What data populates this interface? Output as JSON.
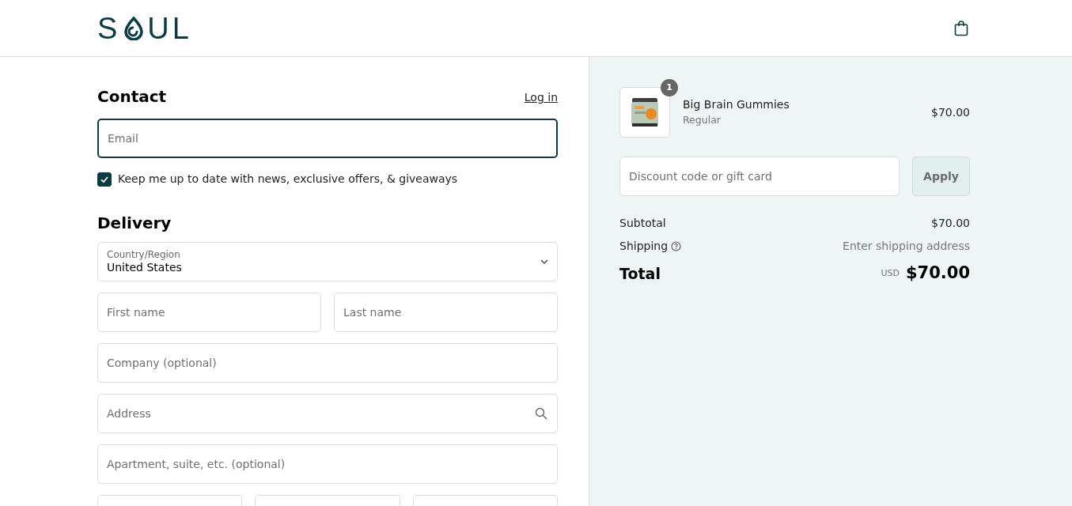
{
  "header": {
    "logo_start": "S",
    "logo_end": "UL"
  },
  "contact": {
    "title": "Contact",
    "login_link": "Log in",
    "email": {
      "placeholder": "Email"
    },
    "newsletter": {
      "label": "Keep me up to date with news, exclusive offers, & giveaways",
      "checked": true
    }
  },
  "delivery": {
    "title": "Delivery",
    "country": {
      "label": "Country/Region",
      "value": "United States"
    },
    "rows": [
      [
        {
          "placeholder": "First name"
        },
        {
          "placeholder": "Last name"
        }
      ],
      [
        {
          "placeholder": "Company (optional)"
        }
      ],
      [
        {
          "placeholder": "Address",
          "kind": "search"
        }
      ],
      [
        {
          "placeholder": "Apartment, suite, etc. (optional)"
        }
      ],
      [
        {
          "kind": "cut"
        },
        {
          "kind": "cut"
        },
        {
          "kind": "cut"
        }
      ]
    ]
  },
  "summary": {
    "items": [
      {
        "name": "Big Brain Gummies",
        "variant": "Regular",
        "quantity": "1",
        "price": "$70.00"
      }
    ],
    "discount": {
      "placeholder": "Discount code or gift card",
      "button": "Apply"
    },
    "subtotal": {
      "label": "Subtotal",
      "value": "$70.00"
    },
    "shipping": {
      "label": "Shipping",
      "value": "Enter shipping address"
    },
    "total": {
      "label": "Total",
      "currency": "USD",
      "value": "$70.00"
    }
  }
}
